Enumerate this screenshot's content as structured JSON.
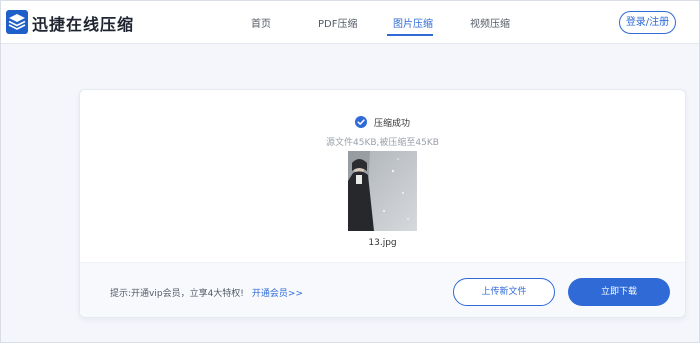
{
  "header": {
    "brand": "迅捷在线压缩",
    "nav": [
      {
        "label": "首页"
      },
      {
        "label": "PDF压缩"
      },
      {
        "label": "图片压缩"
      },
      {
        "label": "视频压缩"
      }
    ],
    "active_nav": "图片压缩",
    "login_label": "登录/注册"
  },
  "result": {
    "status": "压缩成功",
    "detail": "源文件45KB,被压缩至45KB",
    "file_name": "13.jpg"
  },
  "footer": {
    "tip": "提示:开通vip会员，立享4大特权!",
    "tip_link": "开通会员>>",
    "upload_label": "上传新文件",
    "download_label": "立即下载"
  },
  "colors": {
    "accent": "#2f6ad7",
    "page_bg": "#f4f6fb",
    "card_bg": "#ffffff"
  },
  "icons": {
    "logo": "stacked-layers-logo-icon",
    "status": "check-circle-icon"
  }
}
